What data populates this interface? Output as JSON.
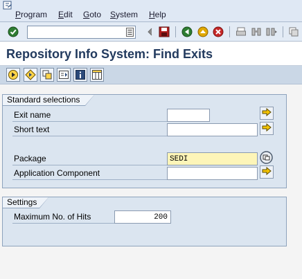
{
  "menu": {
    "items": [
      "Program",
      "Edit",
      "Goto",
      "System",
      "Help"
    ],
    "underline": [
      "P",
      "E",
      "G",
      "S",
      "H"
    ]
  },
  "toolbar": {
    "command_value": "",
    "icons": [
      "enter-icon",
      "history-dropdown-icon",
      "back-nav-icon",
      "save-icon",
      "back-icon",
      "exit-icon",
      "cancel-icon",
      "print-icon",
      "find-icon",
      "find-next-icon",
      "create-session-icon"
    ]
  },
  "title": "Repository Info System: Find Exits",
  "app_toolbar": {
    "icons": [
      "execute-icon",
      "other-selections-icon",
      "copy-selections-icon",
      "dynamic-selection-icon",
      "information-icon",
      "layout-icon"
    ]
  },
  "standard_selections": {
    "title": "Standard selections",
    "fields": [
      {
        "label": "Exit name",
        "value": ""
      },
      {
        "label": "Short text",
        "value": ""
      },
      {
        "label": "Package",
        "value": "SEDI"
      },
      {
        "label": "Application Component",
        "value": ""
      }
    ]
  },
  "settings": {
    "title": "Settings",
    "fields": [
      {
        "label": "Maximum No. of Hits",
        "value": "200"
      }
    ]
  },
  "colors": {
    "menubar": "#dfe8f4",
    "title": "#223a5e",
    "group_bg": "#dbe5f0",
    "required_field": "#fdf5b8",
    "accent_yellow": "#f5c400"
  }
}
